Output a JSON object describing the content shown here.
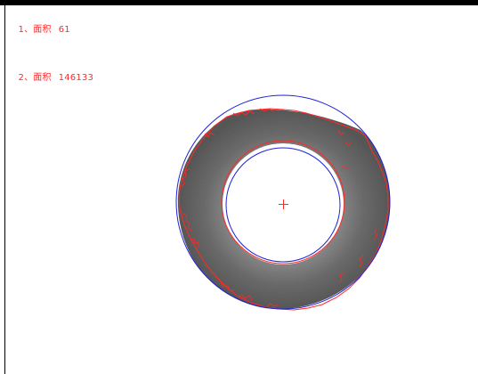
{
  "colors": {
    "annotation": "#ff2a2a",
    "fit_circle": "#1f22d8",
    "background": "#ffffff",
    "frame": "#000000"
  },
  "readout": [
    {
      "index": "1、",
      "label": "面积",
      "value": "61"
    },
    {
      "index": "2、",
      "label": "面积",
      "value": "146133"
    }
  ],
  "icons": {
    "center_marker": "crosshair-plus-icon"
  }
}
